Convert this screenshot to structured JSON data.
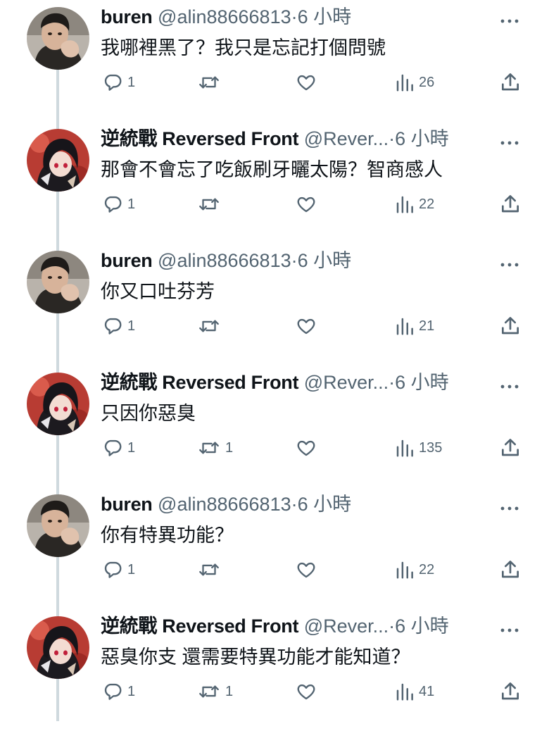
{
  "tweets": [
    {
      "name": "buren",
      "handle": "@alin88666813",
      "sep": "·",
      "time": "6 小時",
      "text": "我哪裡黑了？我只是忘記打個問號",
      "replies": "1",
      "retweets": "",
      "views": "26",
      "avatar": "buren"
    },
    {
      "name": "逆統戰 Reversed Front",
      "handle": "@Rever...",
      "sep": "·",
      "time": "6 小時",
      "text": "那會不會忘了吃飯刷牙曬太陽？智商感人",
      "replies": "1",
      "retweets": "",
      "views": "22",
      "avatar": "anime"
    },
    {
      "name": "buren",
      "handle": "@alin88666813",
      "sep": "·",
      "time": "6 小時",
      "text": "你又口吐芬芳",
      "replies": "1",
      "retweets": "",
      "views": "21",
      "avatar": "buren"
    },
    {
      "name": "逆統戰 Reversed Front",
      "handle": "@Rever...",
      "sep": "·",
      "time": "6 小時",
      "text": "只因你惡臭",
      "replies": "1",
      "retweets": "1",
      "views": "135",
      "avatar": "anime"
    },
    {
      "name": "buren",
      "handle": "@alin88666813",
      "sep": "·",
      "time": "6 小時",
      "text": "你有特異功能？",
      "replies": "1",
      "retweets": "",
      "views": "22",
      "avatar": "buren"
    },
    {
      "name": "逆統戰 Reversed Front",
      "handle": "@Rever...",
      "sep": "·",
      "time": "6 小時",
      "text": "惡臭你支 還需要特異功能才能知道？",
      "replies": "1",
      "retweets": "1",
      "views": "41",
      "avatar": "anime"
    }
  ],
  "icons": {
    "reply": "reply-icon",
    "retweet": "retweet-icon",
    "like": "heart-icon",
    "views": "views-icon",
    "share": "share-icon",
    "more": "more-icon"
  },
  "colors": {
    "text": "#0f1419",
    "secondary": "#536471",
    "thread_line": "#cfd9de"
  }
}
